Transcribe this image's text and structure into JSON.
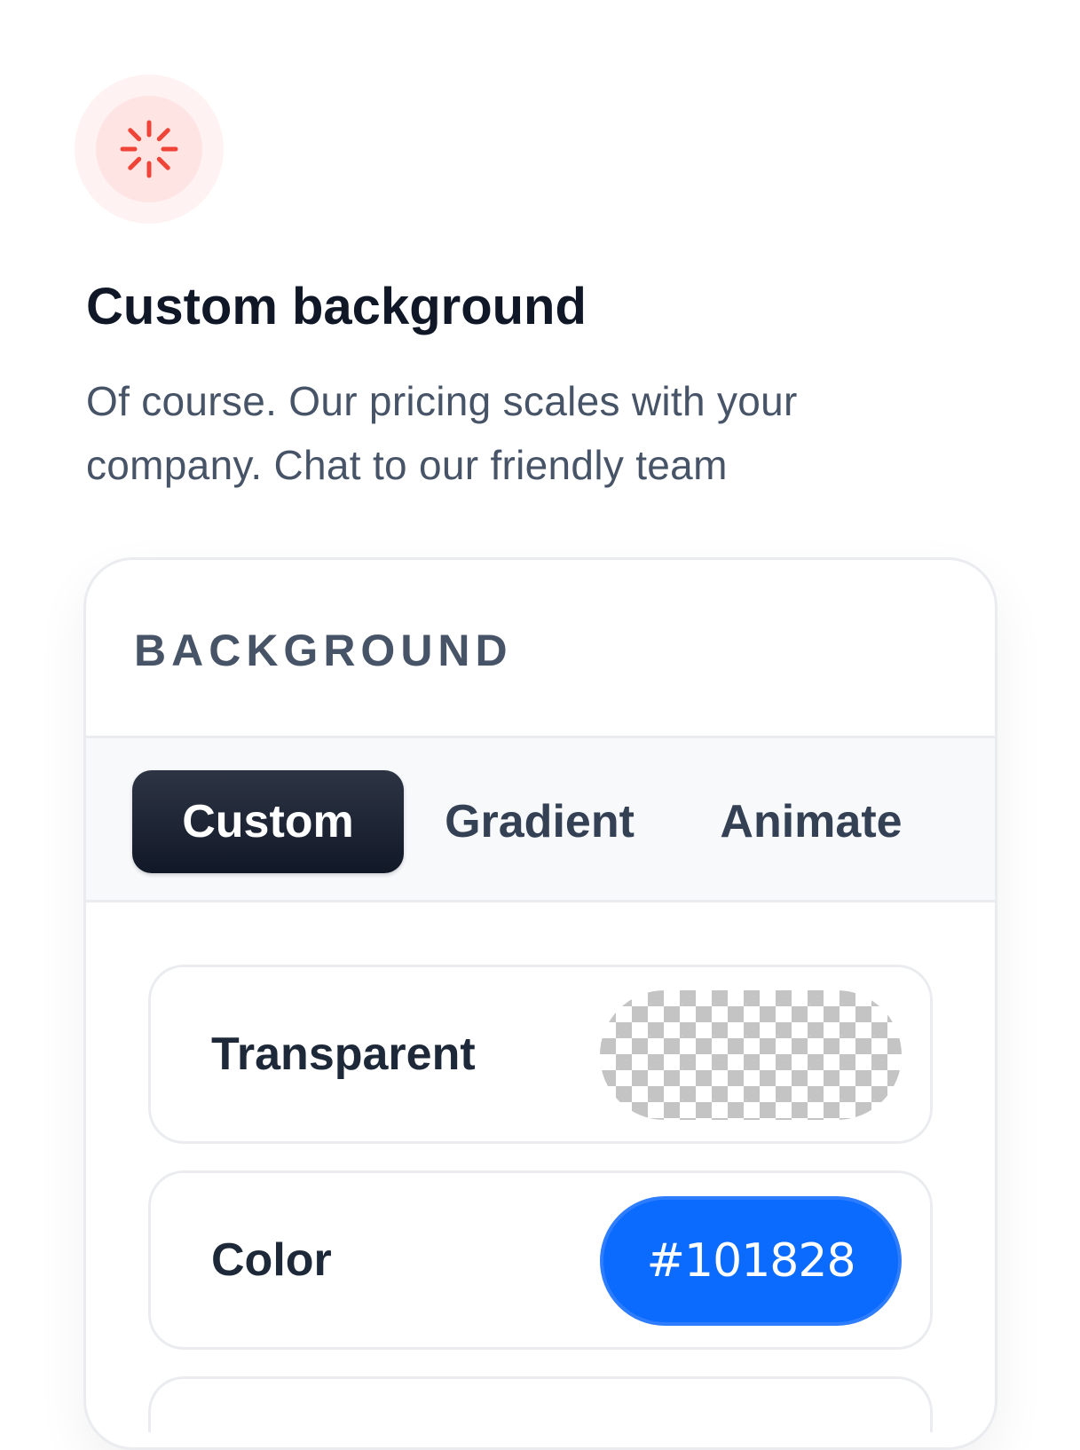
{
  "feature": {
    "icon": "loading-spinner-icon",
    "icon_color": "#f04438",
    "title": "Custom background",
    "description": "Of course. Our pricing scales with your company. Chat to our friendly team"
  },
  "card": {
    "header_label": "BACKGROUND",
    "tabs": [
      {
        "label": "Custom",
        "active": true
      },
      {
        "label": "Gradient",
        "active": false
      },
      {
        "label": "Animate",
        "active": false
      }
    ],
    "options": [
      {
        "label": "Transparent",
        "swatch": "checkerboard"
      },
      {
        "label": "Color",
        "value": "#101828",
        "swatch_color": "#0b6bff"
      }
    ]
  }
}
